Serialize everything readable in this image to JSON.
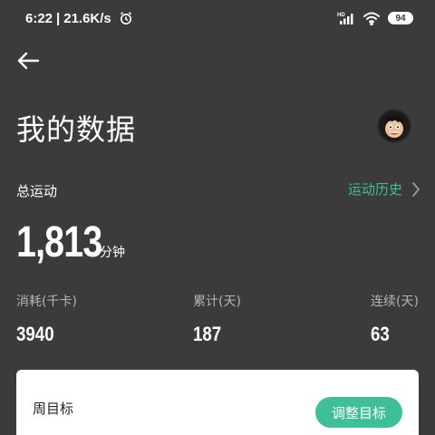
{
  "status_bar": {
    "time": "6:22",
    "separator": "|",
    "speed": "21.6K/s",
    "battery": "94",
    "icons": [
      "alarm-icon",
      "hd-signal-icon",
      "wifi-icon",
      "battery-icon"
    ]
  },
  "header": {
    "title": "我的数据",
    "back_icon": "back-arrow-icon",
    "avatar": "user-avatar"
  },
  "summary": {
    "section_label": "总运动",
    "history_link": "运动历史",
    "total_value": "1,813",
    "total_unit": "分钟"
  },
  "stats": [
    {
      "label": "消耗(千卡)",
      "value": "3940"
    },
    {
      "label": "累计(天)",
      "value": "187"
    },
    {
      "label": "连续(天)",
      "value": "63"
    }
  ],
  "weekly_goal": {
    "title": "周目标",
    "button_label": "调整目标"
  },
  "colors": {
    "background": "#3b3b3b",
    "accent": "#3fbf97",
    "card": "#ffffff"
  }
}
